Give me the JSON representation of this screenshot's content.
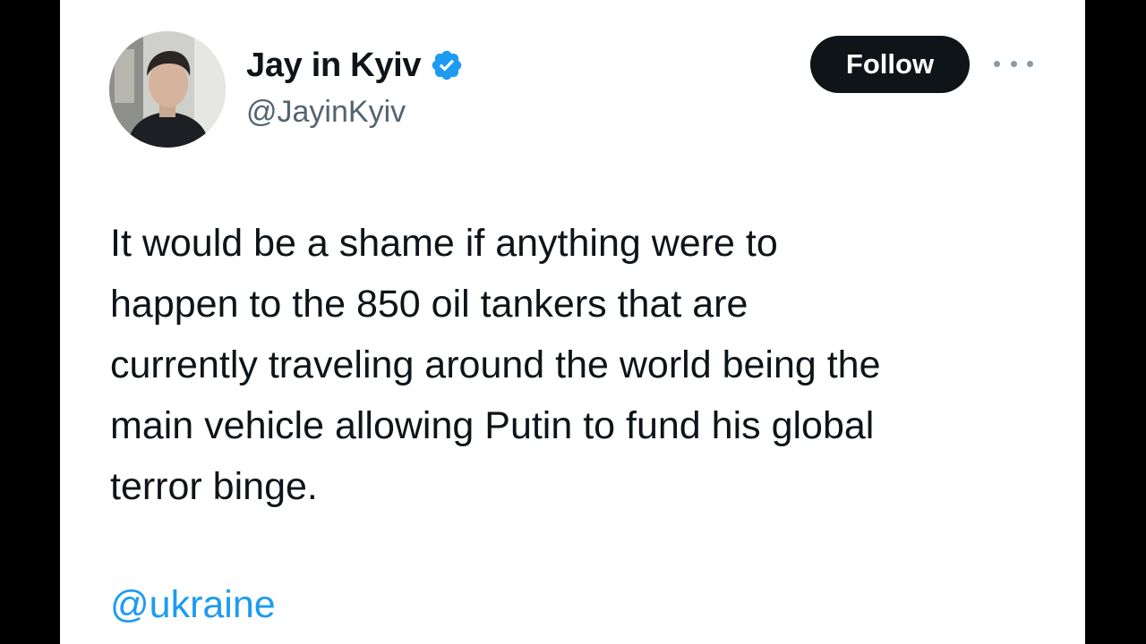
{
  "tweet": {
    "author": {
      "display_name": "Jay in Kyiv",
      "handle": "@JayinKyiv",
      "verified": true,
      "avatar_icon": "user-photo-avatar"
    },
    "follow_label": "Follow",
    "more_icon": "more-dots-icon",
    "text_lines": [
      "It would be a shame if anything were to",
      "happen to the 850 oil tankers that are",
      "currently traveling around the world being the",
      "main vehicle allowing Putin to fund his global",
      "terror binge."
    ],
    "mention": "@ukraine"
  },
  "colors": {
    "background": "#ffffff",
    "side_bars": "#000000",
    "text_primary": "#0f1419",
    "text_secondary": "#536471",
    "link": "#1d9bf0",
    "verified_badge": "#1d9bf0",
    "follow_button_bg": "#0f1419"
  }
}
